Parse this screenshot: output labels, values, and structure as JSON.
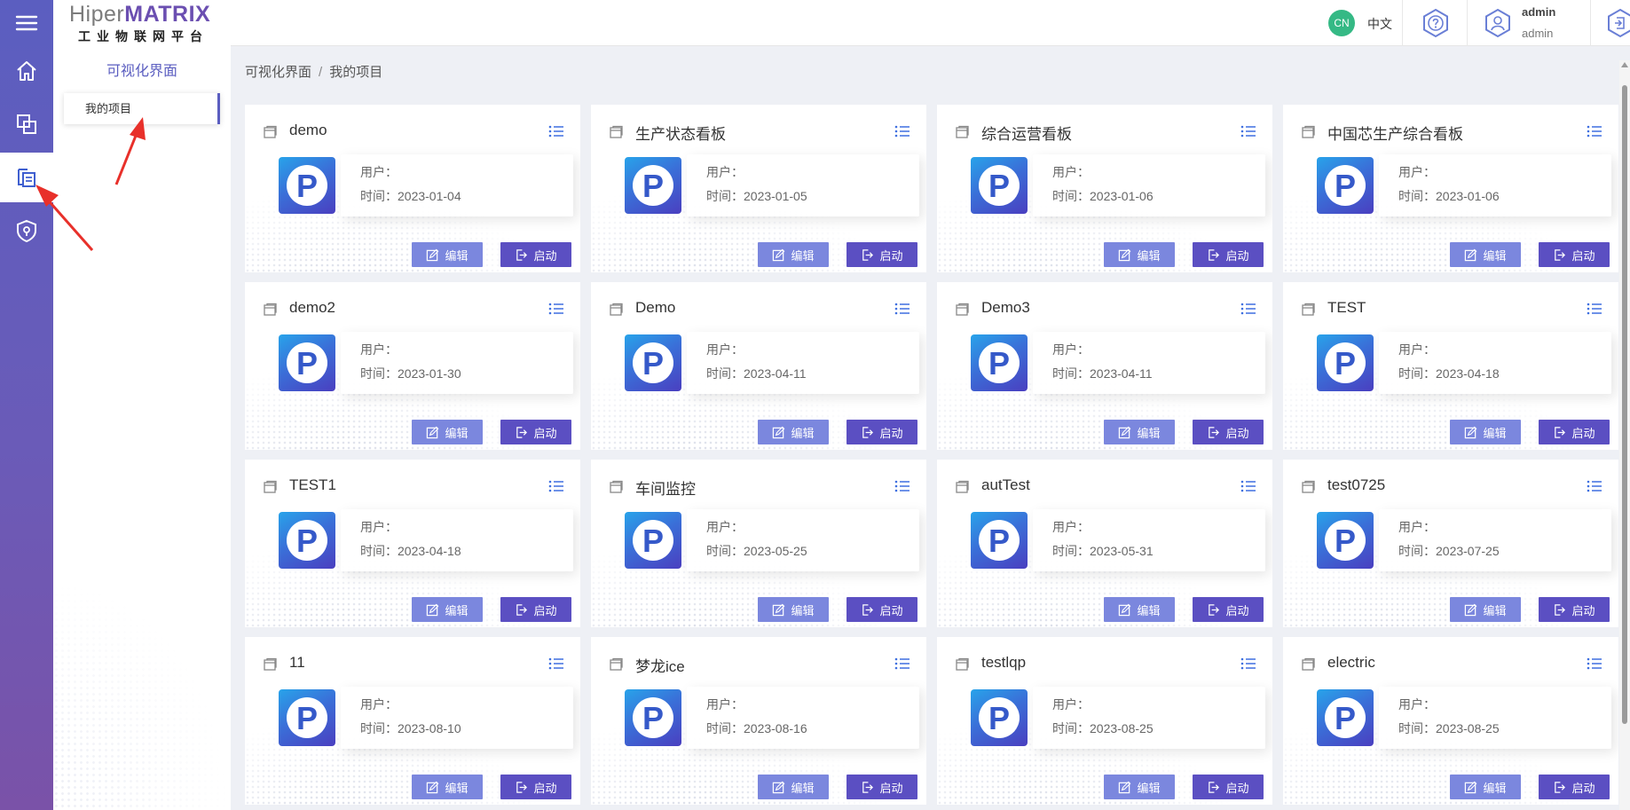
{
  "logo": {
    "part1": "Hiper",
    "part2": "MATRIX",
    "subtitle": "工业物联网平台"
  },
  "subnav": {
    "title": "可视化界面",
    "items": [
      {
        "label": "我的项目"
      }
    ]
  },
  "header": {
    "lang_badge": "CN",
    "lang_label": "中文",
    "user_name": "admin",
    "user_role": "admin"
  },
  "breadcrumb": {
    "root": "可视化界面",
    "sep": "/",
    "current": "我的项目"
  },
  "labels": {
    "user": "用户：",
    "time_prefix": "时间：",
    "edit": "编辑",
    "start": "启动"
  },
  "thumbnail_glyph": "P",
  "colors": {
    "rail_top": "#5b5ec0",
    "rail_bottom": "#7a52a8",
    "edit_button": "#7b87de",
    "start_button": "#5b4fc2",
    "lang_badge": "#35b985"
  },
  "icons": {
    "rail": [
      "home-icon",
      "components-icon",
      "projects-icon",
      "security-icon"
    ],
    "header": [
      "help-icon",
      "user-icon",
      "logout-icon"
    ],
    "card": [
      "window-icon",
      "list-menu-icon",
      "edit-icon",
      "launch-icon"
    ]
  },
  "projects": [
    {
      "name": "demo",
      "user": "",
      "time": "2023-01-04"
    },
    {
      "name": "生产状态看板",
      "user": "",
      "time": "2023-01-05"
    },
    {
      "name": "综合运营看板",
      "user": "",
      "time": "2023-01-06"
    },
    {
      "name": "中国芯生产综合看板",
      "user": "",
      "time": "2023-01-06"
    },
    {
      "name": "demo2",
      "user": "",
      "time": "2023-01-30"
    },
    {
      "name": "Demo",
      "user": "",
      "time": "2023-04-11"
    },
    {
      "name": "Demo3",
      "user": "",
      "time": "2023-04-11"
    },
    {
      "name": "TEST",
      "user": "",
      "time": "2023-04-18"
    },
    {
      "name": "TEST1",
      "user": "",
      "time": "2023-04-18"
    },
    {
      "name": "车间监控",
      "user": "",
      "time": "2023-05-25"
    },
    {
      "name": "autTest",
      "user": "",
      "time": "2023-05-31"
    },
    {
      "name": "test0725",
      "user": "",
      "time": "2023-07-25"
    },
    {
      "name": "11",
      "user": "",
      "time": "2023-08-10"
    },
    {
      "name": "梦龙ice",
      "user": "",
      "time": "2023-08-16"
    },
    {
      "name": "testlqp",
      "user": "",
      "time": "2023-08-25"
    },
    {
      "name": "electric",
      "user": "",
      "time": "2023-08-25"
    }
  ]
}
